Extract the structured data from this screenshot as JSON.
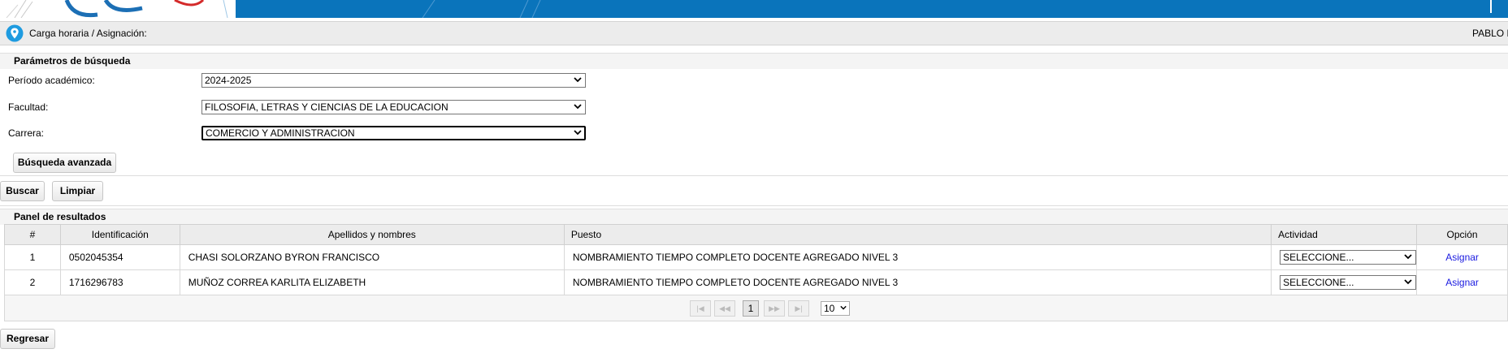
{
  "breadcrumb": {
    "path": "Carga horaria / Asignación:",
    "user": "PABLO F"
  },
  "search": {
    "title": "Parámetros de búsqueda",
    "periodo_label": "Período académico:",
    "periodo_value": "2024-2025",
    "facultad_label": "Facultad:",
    "facultad_value": "FILOSOFIA, LETRAS Y CIENCIAS DE LA EDUCACION",
    "carrera_label": "Carrera:",
    "carrera_value": "COMERCIO Y ADMINISTRACION",
    "advanced_label": "Búsqueda avanzada",
    "buscar_label": "Buscar",
    "limpiar_label": "Limpiar"
  },
  "results": {
    "title": "Panel de resultados",
    "columns": [
      "#",
      "Identificación",
      "Apellidos y nombres",
      "Puesto",
      "Actividad",
      "Opción"
    ],
    "rows": [
      {
        "num": "1",
        "id": "0502045354",
        "name": "CHASI SOLORZANO BYRON FRANCISCO",
        "puesto": "NOMBRAMIENTO TIEMPO COMPLETO DOCENTE AGREGADO NIVEL 3",
        "actividad": "SELECCIONE...",
        "opcion": "Asignar"
      },
      {
        "num": "2",
        "id": "1716296783",
        "name": "MUÑOZ CORREA KARLITA ELIZABETH",
        "puesto": "NOMBRAMIENTO TIEMPO COMPLETO DOCENTE AGREGADO NIVEL 3",
        "actividad": "SELECCIONE...",
        "opcion": "Asignar"
      }
    ]
  },
  "pagination": {
    "first": "|◀",
    "prev": "◀◀",
    "current": "1",
    "next": "▶▶",
    "last": "▶|",
    "rows_per_page": "10"
  },
  "footer": {
    "regresar_label": "Regresar"
  },
  "colors": {
    "banner_blue": "#0a74bb",
    "link_blue": "#1a1ae0",
    "pin_blue": "#1e9be0"
  }
}
